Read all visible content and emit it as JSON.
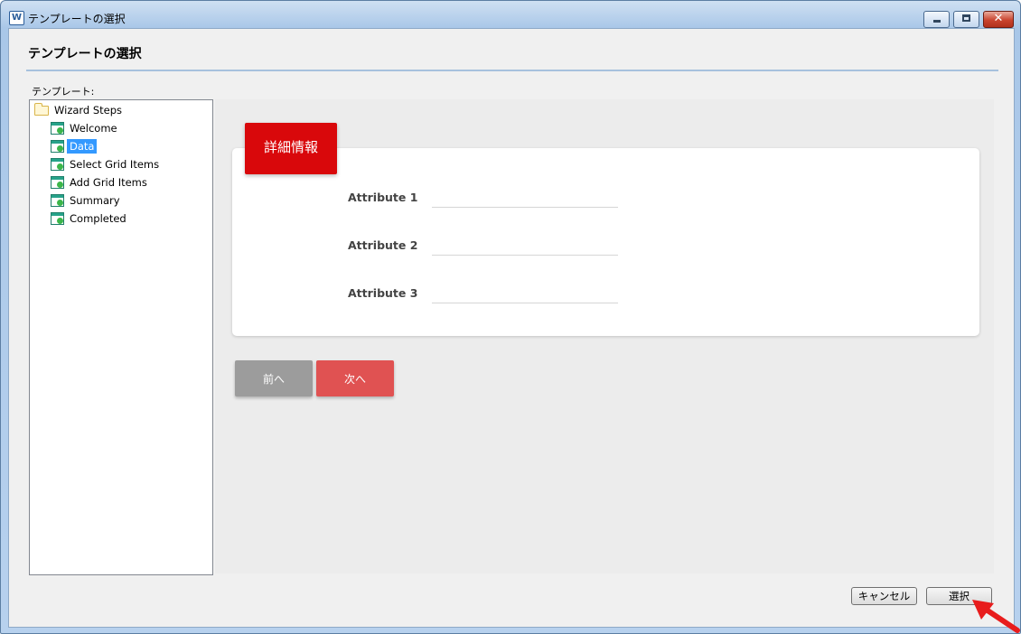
{
  "window": {
    "app_icon_text": "W",
    "title": "テンプレートの選択",
    "close_symbol": "✕"
  },
  "dialog": {
    "heading": "テンプレートの選択",
    "tree_label": "テンプレート:"
  },
  "tree": {
    "root": "Wizard Steps",
    "items": [
      {
        "label": "Welcome",
        "selected": false
      },
      {
        "label": "Data",
        "selected": true
      },
      {
        "label": "Select Grid Items",
        "selected": false
      },
      {
        "label": "Add Grid Items",
        "selected": false
      },
      {
        "label": "Summary",
        "selected": false
      },
      {
        "label": "Completed",
        "selected": false
      }
    ]
  },
  "preview": {
    "section_title": "詳細情報",
    "attributes": [
      {
        "label": "Attribute 1",
        "value": ""
      },
      {
        "label": "Attribute 2",
        "value": ""
      },
      {
        "label": "Attribute 3",
        "value": ""
      }
    ],
    "prev_label": "前へ",
    "next_label": "次へ",
    "accent_color": "#d9080b",
    "next_color": "#e05252",
    "prev_color": "#9c9c9c"
  },
  "buttons": {
    "cancel": "キャンセル",
    "select": "選択"
  },
  "annotation": {
    "arrow_color": "#e81c1c"
  }
}
